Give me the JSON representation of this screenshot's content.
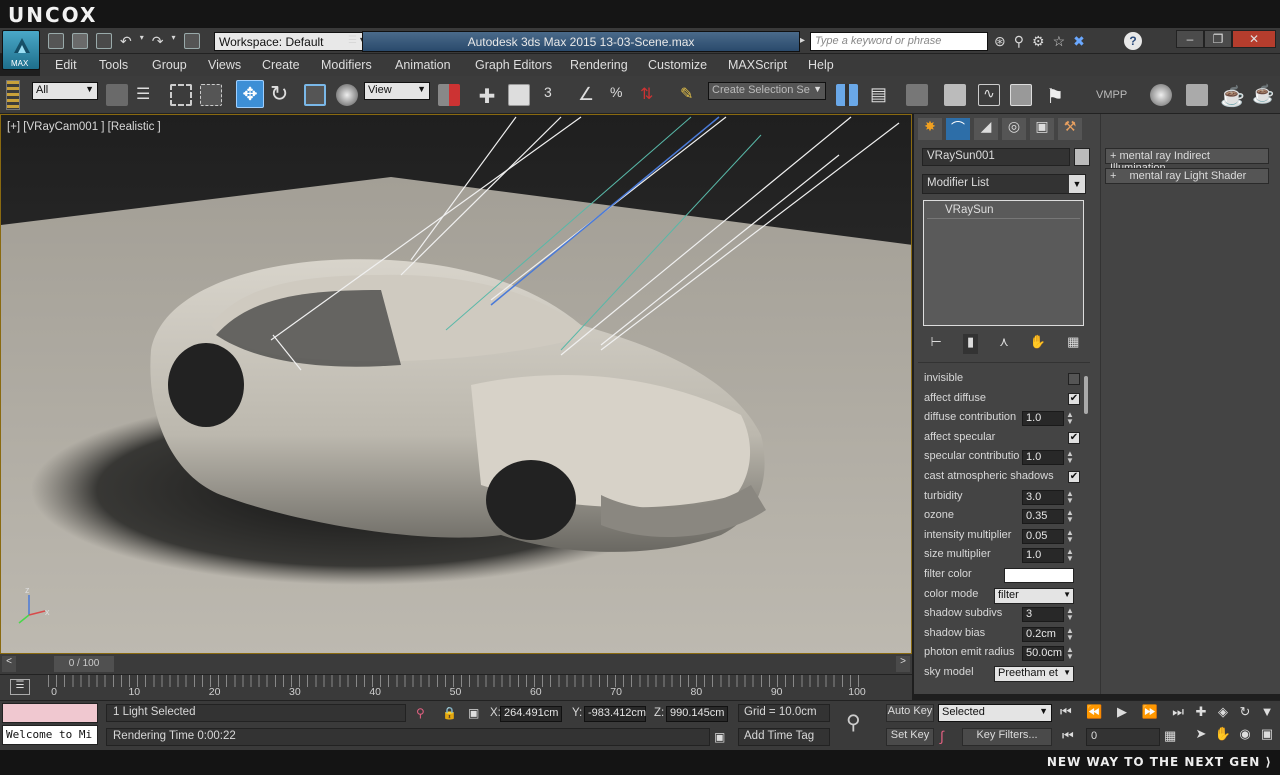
{
  "brand": {
    "logo": "UNCOX"
  },
  "titlebar": {
    "max_label": "MAX",
    "workspace": "Workspace: Default",
    "app_title": "Autodesk 3ds Max  2015     13-03-Scene.max",
    "search_placeholder": "Type a keyword or phrase",
    "help": "?"
  },
  "menu": [
    "Edit",
    "Tools",
    "Group",
    "Views",
    "Create",
    "Modifiers",
    "Animation",
    "Graph Editors",
    "Rendering",
    "Customize",
    "MAXScript",
    "Help"
  ],
  "toolbar": {
    "filter": "All",
    "ref_coord": "View",
    "snap_label": "3",
    "create_selection_set": "Create Selection Se",
    "vmpp": "VMPP"
  },
  "viewport": {
    "label": "[+] [VRayCam001 ] [Realistic ]"
  },
  "command_panel": {
    "object_name": "VRaySun001",
    "modifier_list": "Modifier List",
    "stack_item": "VRaySun",
    "params": [
      {
        "label": "invisible",
        "type": "check",
        "checked": false
      },
      {
        "label": "affect diffuse",
        "type": "check",
        "checked": true
      },
      {
        "label": "diffuse contribution",
        "type": "spin",
        "value": "1.0"
      },
      {
        "label": "affect specular",
        "type": "check",
        "checked": true
      },
      {
        "label": "specular contributio",
        "type": "spin",
        "value": "1.0"
      },
      {
        "label": "cast atmospheric shadows",
        "type": "check",
        "checked": true
      },
      {
        "label": "turbidity",
        "type": "spin",
        "value": "3.0"
      },
      {
        "label": "ozone",
        "type": "spin",
        "value": "0.35"
      },
      {
        "label": "intensity multiplier",
        "type": "spin",
        "value": "0.05"
      },
      {
        "label": "size multiplier",
        "type": "spin",
        "value": "1.0"
      },
      {
        "label": "filter color",
        "type": "color",
        "value": "#ffffff"
      },
      {
        "label": "color mode",
        "type": "dropdown",
        "value": "filter"
      },
      {
        "label": "shadow subdivs",
        "type": "spin",
        "value": "3"
      },
      {
        "label": "shadow bias",
        "type": "spin",
        "value": "0.2cm"
      },
      {
        "label": "photon emit radius",
        "type": "spin",
        "value": "50.0cm"
      },
      {
        "label": "sky model",
        "type": "dropdown",
        "value": "Preetham et"
      }
    ]
  },
  "right_panel": {
    "items": [
      {
        "sign": "+",
        "label": "mental ray Indirect Illumination"
      },
      {
        "sign": "+",
        "label": "mental ray Light Shader"
      }
    ]
  },
  "timeline": {
    "frame_label": "0 / 100",
    "ticks": [
      "0",
      "10",
      "20",
      "30",
      "40",
      "50",
      "60",
      "70",
      "80",
      "90",
      "100"
    ]
  },
  "status": {
    "listener": "Welcome to Mi",
    "selection": "1 Light Selected",
    "render_time": "Rendering Time  0:00:22",
    "x": "264.491cm",
    "y": "-983.412cm",
    "z": "990.145cm",
    "x_label": "X:",
    "y_label": "Y:",
    "z_label": "Z:",
    "grid": "Grid = 10.0cm",
    "add_time_tag": "Add Time Tag",
    "auto_key": "Auto Key",
    "set_key": "Set Key",
    "key_mode": "Selected",
    "key_filters": "Key Filters...",
    "current_frame": "0"
  },
  "footer": {
    "tagline": "NEW WAY TO THE NEXT GEN ⟩"
  },
  "colors": {
    "accent": "#2d6ea8",
    "viewport_border": "#e0a400",
    "ground": "#b9b6ad"
  }
}
